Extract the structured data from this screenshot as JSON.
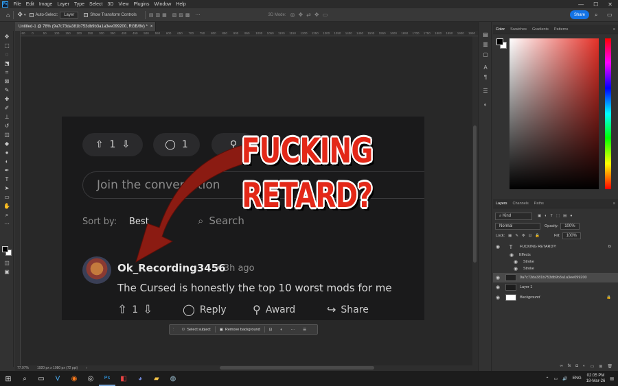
{
  "menubar": {
    "app_icon": "Ps",
    "items": [
      "File",
      "Edit",
      "Image",
      "Layer",
      "Type",
      "Select",
      "3D",
      "View",
      "Plugins",
      "Window",
      "Help"
    ],
    "window_buttons": [
      "—",
      "☐",
      "✕"
    ]
  },
  "options": {
    "auto_select_label": "Auto-Select:",
    "auto_select_value": "Layer",
    "transform_label": "Show Transform Controls",
    "mode_label": "3D Mode:",
    "share_label": "Share"
  },
  "document": {
    "tab_title": "Untitled-1 @ 78% (9a7c73da381b753db9b3a1a3ee099200, RGB/8#) *",
    "tab_close": "×",
    "zoom": "77.97%",
    "doc_size": "1920 px x 1080 px (72 ppi)",
    "ruler_labels": [
      "-50",
      "0",
      "50",
      "100",
      "150",
      "200",
      "250",
      "300",
      "350",
      "400",
      "450",
      "500",
      "550",
      "600",
      "650",
      "700",
      "750",
      "800",
      "850",
      "900",
      "950",
      "1000",
      "1050",
      "1100",
      "1150",
      "1200",
      "1250",
      "1300",
      "1350",
      "1400",
      "1450",
      "1500",
      "1550",
      "1600",
      "1650",
      "1700",
      "1750",
      "1800",
      "1850",
      "1900",
      "1950"
    ]
  },
  "image": {
    "vote_count": "1",
    "comment_count": "1",
    "join_placeholder": "Join the conversation",
    "sort_label": "Sort by:",
    "sort_value": "Best",
    "search_label": "Search",
    "username": "Ok_Recording3456",
    "time": "• 3h ago",
    "comment_text": "The Cursed is honestly the top 10 worst mods for me",
    "reply_label": "Reply",
    "award_label": "Award",
    "share_label": "Share",
    "overlay_line1": "FUCKING",
    "overlay_line2": "RETARD?",
    "arrow_color": "#8b1b12",
    "overlay_color": "#e32818"
  },
  "context_bar": {
    "select_subject": "Select subject",
    "remove_background": "Remove background",
    "more": "···"
  },
  "color_panel": {
    "tabs": [
      "Color",
      "Swatches",
      "Gradients",
      "Patterns"
    ],
    "active_tab": "Color",
    "hue_color": "#e53128"
  },
  "layers_panel": {
    "tabs": [
      "Layers",
      "Channels",
      "Paths"
    ],
    "active_tab": "Layers",
    "kind_label": "Kind",
    "blend_mode": "Normal",
    "opacity_label": "Opacity:",
    "opacity_value": "100%",
    "lock_label": "Lock:",
    "fill_label": "Fill:",
    "fill_value": "100%",
    "layers": [
      {
        "name": "FUCKING RETARD?!",
        "type": "text",
        "fx": "fx"
      },
      {
        "name": "Effects",
        "type": "effects"
      },
      {
        "name": "Stroke",
        "type": "effect"
      },
      {
        "name": "Stroke",
        "type": "effect"
      },
      {
        "name": "9a7c73da381b753db9b3a1a3ee099200",
        "type": "image",
        "selected": true
      },
      {
        "name": "Layer 1",
        "type": "image"
      },
      {
        "name": "Background",
        "type": "background"
      }
    ]
  },
  "taskbar": {
    "lang": "ENG",
    "time": "02:05 PM",
    "date": "18-Mar-26"
  }
}
